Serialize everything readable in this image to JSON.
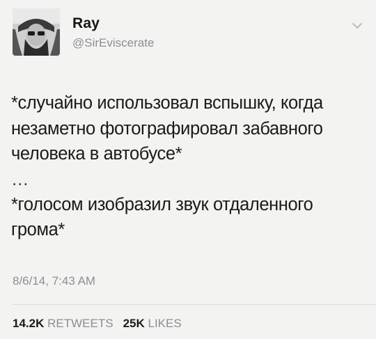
{
  "tweet": {
    "author": {
      "display_name": "Ray",
      "handle": "@SirEviscerate"
    },
    "body": {
      "line1": "*случайно использовал вспышку, когда незаметно фотографировал забавного человека в автобусе*",
      "ellipsis": "…",
      "line2": "*голосом изобразил звук отдаленного грома*"
    },
    "timestamp": "8/6/14, 7:43 AM",
    "stats": {
      "retweets_count": "14.2K",
      "retweets_label": "RETWEETS",
      "likes_count": "25K",
      "likes_label": "LIKES"
    },
    "icons": {
      "menu": "chevron-down-icon"
    },
    "colors": {
      "background": "#f3f3f1",
      "text": "#1a1a1a",
      "secondary": "#8a8f94"
    }
  }
}
